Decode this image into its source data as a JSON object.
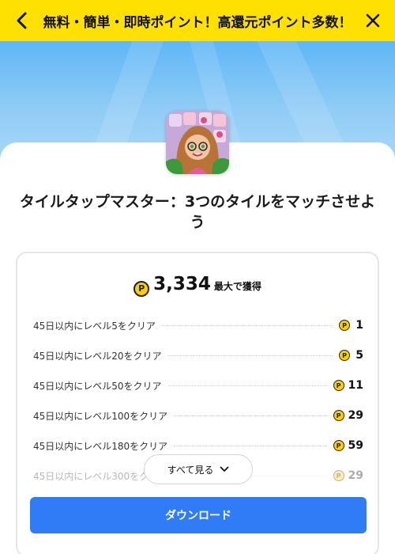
{
  "header": {
    "title": "無料・簡単・即時ポイント！高還元ポイント多数！",
    "back_icon": "chevron-left-icon",
    "close_icon": "close-icon",
    "bg_color": "#ffe100"
  },
  "app": {
    "title": "タイルタップマスター：3つのタイルをマッチさせよう",
    "icon": "game-app-icon"
  },
  "reward": {
    "coin_symbol": "P",
    "total": "3,334",
    "suffix": "最大で獲得"
  },
  "tasks": [
    {
      "label": "45日以内にレベル5をクリア",
      "points": "1"
    },
    {
      "label": "45日以内にレベル20をクリア",
      "points": "5"
    },
    {
      "label": "45日以内にレベル50をクリア",
      "points": "11"
    },
    {
      "label": "45日以内にレベル100をクリア",
      "points": "29"
    },
    {
      "label": "45日以内にレベル180をクリア",
      "points": "59"
    },
    {
      "label": "45日以内にレベル300をクリア",
      "points": "29"
    }
  ],
  "actions": {
    "see_all": "すべて見る",
    "download": "ダウンロード",
    "accent_color": "#2f7cf6"
  }
}
